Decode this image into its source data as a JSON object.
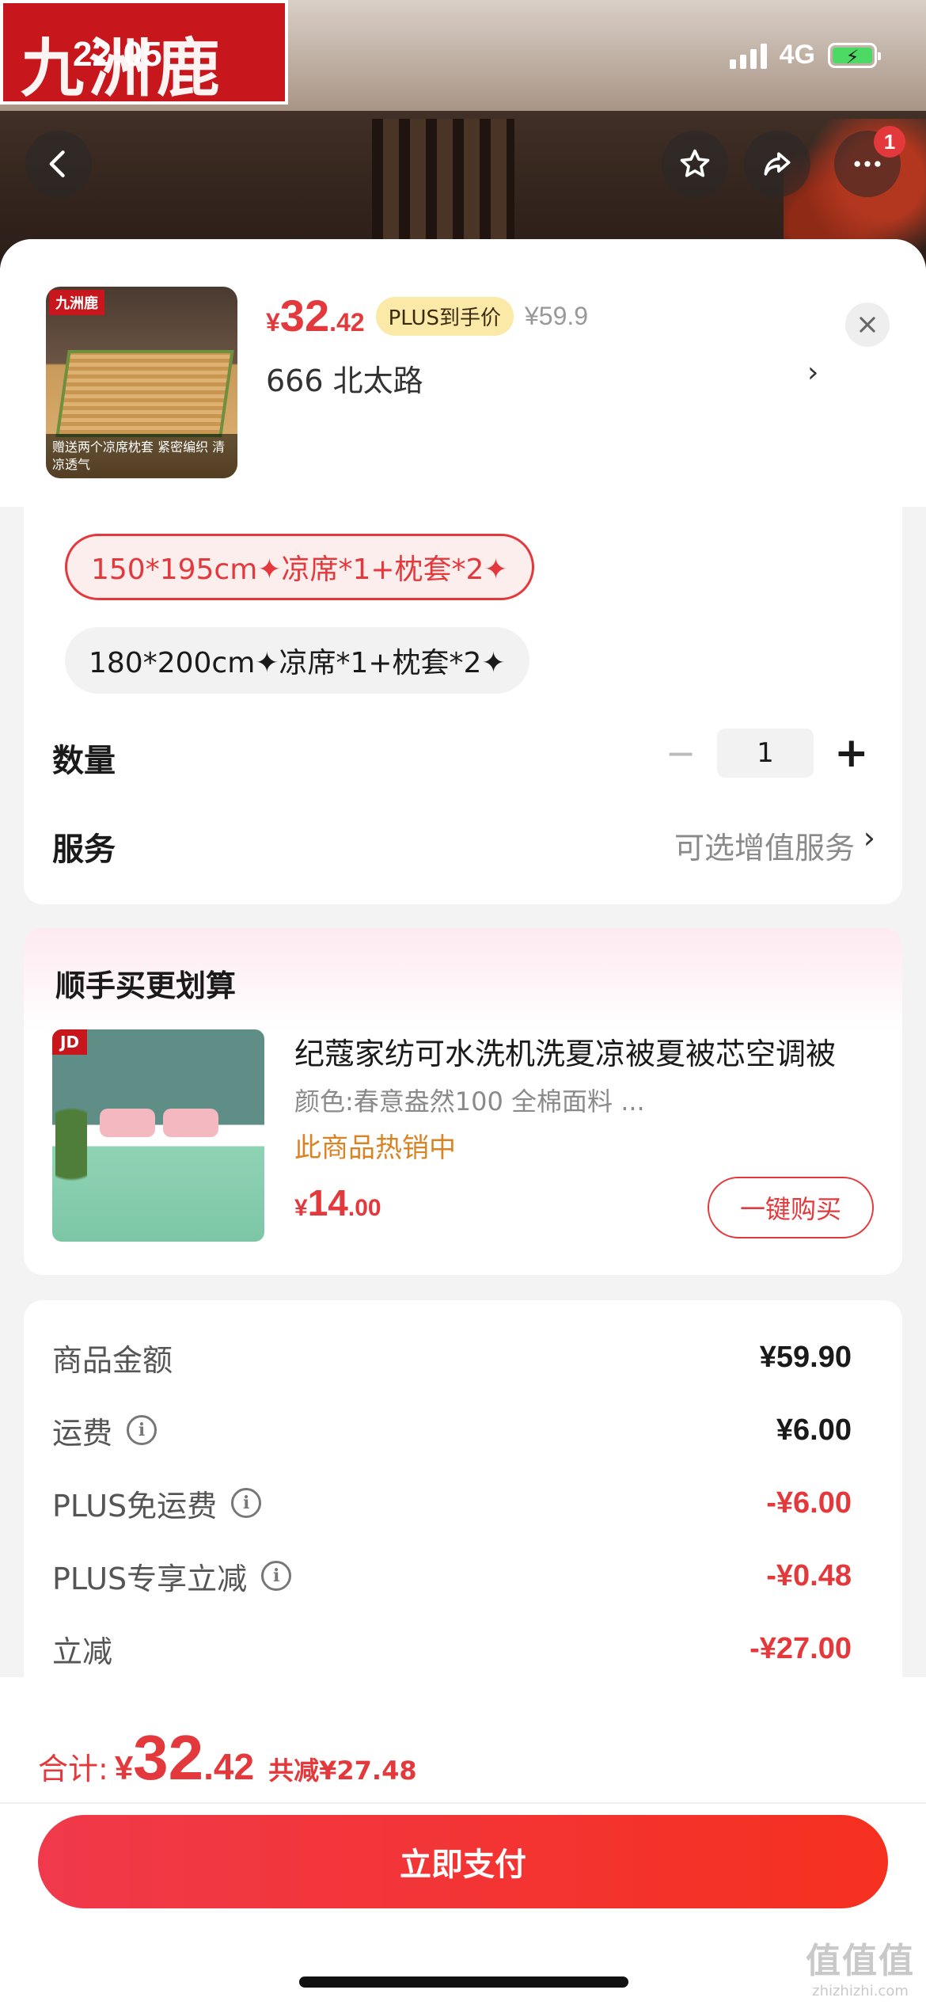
{
  "status_bar": {
    "time": "22:05",
    "network": "4G"
  },
  "brand_sign": "九洲鹿",
  "header": {
    "price_symbol": "¥",
    "price_int": "32",
    "price_dec": ".42",
    "plus_tag": "PLUS到手价",
    "original_price": "¥59.9",
    "address": "666  北太路",
    "address_arrow": "›",
    "thumb_logo": "九洲鹿",
    "thumb_caption": "赠送两个凉席枕套 紧密编织 清凉透气"
  },
  "specs": {
    "options": [
      "150*195cm✦凉席*1+枕套*2✦",
      "180*200cm✦凉席*1+枕套*2✦"
    ],
    "selected_index": 0,
    "quantity_label": "数量",
    "quantity_minus": "−",
    "quantity_value": "1",
    "quantity_plus": "+",
    "service_label": "服务",
    "service_value": "可选增值服务",
    "service_arrow": "›"
  },
  "bundle": {
    "title": "顺手买更划算",
    "product_name": "纪蔻家纺可水洗机洗夏凉被夏被芯空调被",
    "product_spec": "颜色:春意盎然100 全棉面料  ...",
    "hot_text": "此商品热销中",
    "price_symbol": "¥",
    "price_int": "14",
    "price_dec": ".00",
    "buy_label": "一键购买",
    "img_logo": "JD"
  },
  "costs": [
    {
      "label": "商品金额",
      "info": false,
      "value": "¥59.90",
      "red": false
    },
    {
      "label": "运费",
      "info": true,
      "value": "¥6.00",
      "red": false
    },
    {
      "label": "PLUS免运费",
      "info": true,
      "value": "-¥6.00",
      "red": true
    },
    {
      "label": "PLUS专享立减",
      "info": true,
      "value": "-¥0.48",
      "red": true
    },
    {
      "label": "立减",
      "info": false,
      "value": "-¥27.00",
      "red": true
    }
  ],
  "footer": {
    "total_label": "合计:",
    "total_symbol": "¥",
    "total_int": "32",
    "total_dec": ".42",
    "saved_text": "共减¥27.48",
    "pay_label": "立即支付"
  },
  "watermark": {
    "big": "值值值",
    "small": "zhizhizhi.com"
  },
  "colors": {
    "accent": "#e4393c",
    "plus_tag_bg": "#fbe9a7",
    "hot_text": "#d98324"
  },
  "icons": [
    "back-icon",
    "star-icon",
    "share-icon",
    "more-icon",
    "close-icon",
    "info-icon"
  ]
}
